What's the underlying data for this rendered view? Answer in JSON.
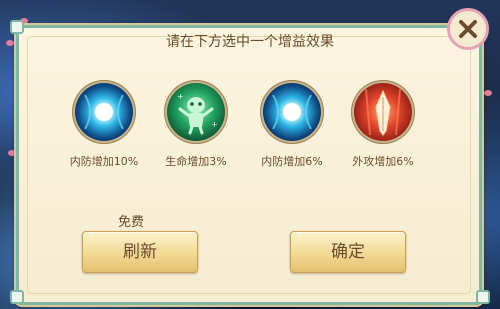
{
  "dialog": {
    "title": "请在下方选中一个增益效果",
    "free_label": "免费",
    "refresh_label": "刷新",
    "confirm_label": "确定"
  },
  "buffs": [
    {
      "label": "内防增加10%",
      "icon": "blue-orb-icon"
    },
    {
      "label": "生命增加3%",
      "icon": "green-spirit-icon"
    },
    {
      "label": "内防增加6%",
      "icon": "blue-orb-icon"
    },
    {
      "label": "外攻增加6%",
      "icon": "red-blade-icon"
    }
  ],
  "colors": {
    "panel_bg": "#fbf4df",
    "panel_border": "#7fb7a5",
    "text": "#6b4b2e",
    "button_gold": "#f2d992",
    "close_pink": "#e7a1b5"
  }
}
